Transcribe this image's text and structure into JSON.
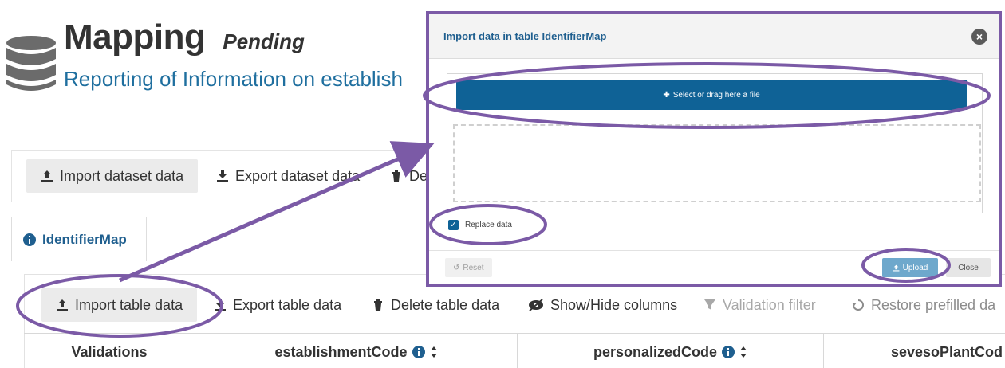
{
  "page": {
    "title": "Mapping",
    "status": "Pending",
    "subtitle": "Reporting of Information on establish"
  },
  "dataset_toolbar": {
    "import_label": "Import dataset data",
    "export_label": "Export dataset data",
    "delete_label": "De"
  },
  "tab": {
    "label": "IdentifierMap"
  },
  "table_toolbar": {
    "import_label": "Import table data",
    "export_label": "Export table data",
    "delete_label": "Delete table data",
    "show_hide_label": "Show/Hide columns",
    "validation_filter_label": "Validation filter",
    "restore_label": "Restore prefilled da"
  },
  "table": {
    "columns": [
      "Validations",
      "establishmentCode",
      "personalizedCode",
      "sevesoPlantCod"
    ]
  },
  "modal": {
    "title": "Import data in table IdentifierMap",
    "select_file_label": "Select or drag here a file",
    "replace_data_label": "Replace data",
    "replace_data_checked": true,
    "reset_label": "Reset",
    "upload_label": "Upload",
    "close_label": "Close"
  },
  "colors": {
    "accent": "#0f6296",
    "highlight": "#7b5aa6",
    "subtitle": "#1f6f9f"
  }
}
